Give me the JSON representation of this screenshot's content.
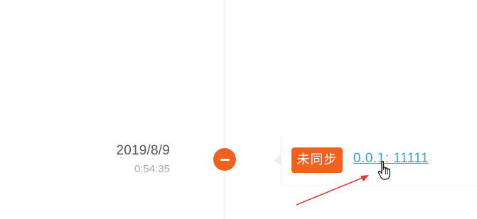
{
  "timeline": {
    "entry": {
      "date": "2019/8/9",
      "time": "0:54:35",
      "status": {
        "label": "未同步",
        "color": "#f0601f"
      },
      "link": {
        "text": "0.0.1: 11111",
        "color": "#3aa3e3"
      },
      "node_icon": "minus-circle-icon"
    }
  },
  "annotation": {
    "arrow_color": "#e53935",
    "cursor_icon": "hand-pointer-icon"
  }
}
